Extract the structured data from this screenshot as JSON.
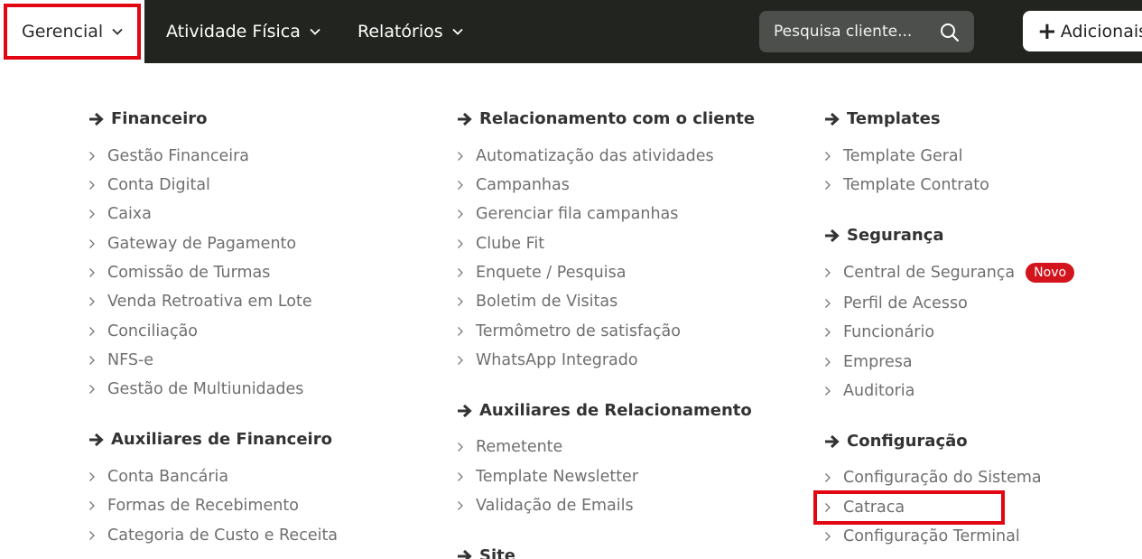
{
  "topbar": {
    "nav": [
      {
        "label": "Gerencial"
      },
      {
        "label": "Atividade Física"
      },
      {
        "label": "Relatórios"
      }
    ],
    "search_placeholder": "Pesquisa cliente...",
    "add_label": "Adicionais"
  },
  "menu": {
    "financeiro": {
      "title": "Financeiro",
      "items": [
        "Gestão Financeira",
        "Conta Digital",
        "Caixa",
        "Gateway de Pagamento",
        "Comissão de Turmas",
        "Venda Retroativa em Lote",
        "Conciliação",
        "NFS-e",
        "Gestão de Multiunidades"
      ]
    },
    "aux_financeiro": {
      "title": "Auxiliares de Financeiro",
      "items": [
        "Conta Bancária",
        "Formas de Recebimento",
        "Categoria de Custo e Receita"
      ]
    },
    "relacionamento": {
      "title": "Relacionamento com o cliente",
      "items": [
        "Automatização das atividades",
        "Campanhas",
        "Gerenciar fila campanhas",
        "Clube Fit",
        "Enquete / Pesquisa",
        "Boletim de Visitas",
        "Termômetro de satisfação",
        "WhatsApp Integrado"
      ]
    },
    "aux_relacionamento": {
      "title": "Auxiliares de Relacionamento",
      "items": [
        "Remetente",
        "Template Newsletter",
        "Validação de Emails"
      ]
    },
    "site": {
      "title": "Site"
    },
    "templates": {
      "title": "Templates",
      "items": [
        "Template Geral",
        "Template Contrato"
      ]
    },
    "seguranca": {
      "title": "Segurança",
      "items": [
        "Central de Segurança",
        "Perfil de Acesso",
        "Funcionário",
        "Empresa",
        "Auditoria"
      ],
      "badge": "Novo"
    },
    "configuracao": {
      "title": "Configuração",
      "items": [
        "Configuração do Sistema",
        "Catraca",
        "Configuração Terminal"
      ]
    }
  },
  "colors": {
    "topbar": "#22241f",
    "highlight": "#e20613",
    "badge": "#d3141d"
  }
}
